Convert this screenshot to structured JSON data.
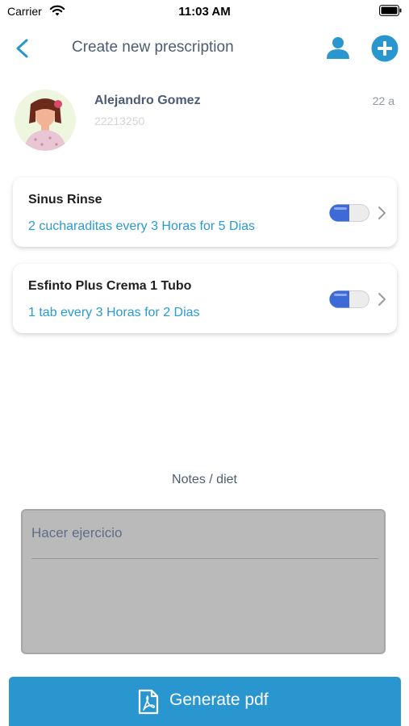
{
  "status_bar": {
    "carrier": "Carrier",
    "time": "11:03 AM"
  },
  "nav": {
    "title": "Create new prescription"
  },
  "patient": {
    "name": "Alejandro Gomez",
    "id": "22213250",
    "age": "22 a"
  },
  "prescriptions": [
    {
      "name": "Sinus Rinse",
      "dosage": "2 cucharaditas every 3 Horas for 5 Dias"
    },
    {
      "name": "Esfinto Plus Crema 1 Tubo",
      "dosage": "1 tab every 3 Horas for 2 Dias"
    }
  ],
  "notes": {
    "label": "Notes / diet",
    "value": "Hacer ejercicio"
  },
  "generate_button": {
    "label": "Generate pdf"
  },
  "colors": {
    "accent": "#2a96d0",
    "title_text": "#4d5d70",
    "dosage_text": "#2a9ad2",
    "notes_bg": "#bababa"
  },
  "icons": [
    "back-chevron-icon",
    "person-icon",
    "add-circle-icon",
    "pill-icon",
    "chevron-right-icon",
    "pdf-file-icon",
    "wifi-icon",
    "battery-icon"
  ]
}
